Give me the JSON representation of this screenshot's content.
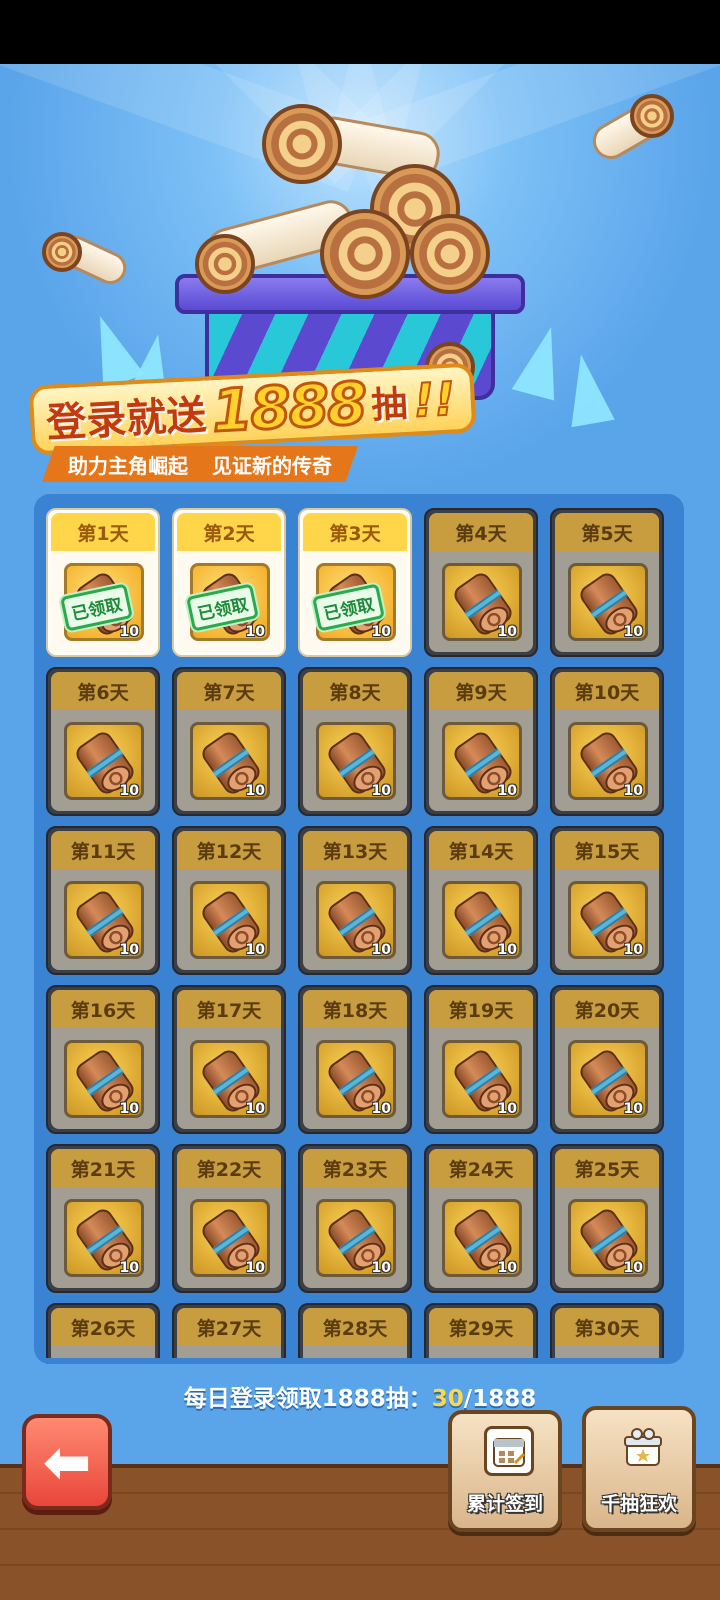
{
  "banner": {
    "title_prefix": "登录就送",
    "title_number": "1888",
    "title_suffix": "抽",
    "title_bang": "!!",
    "subtitle_left": "助力主角崛起",
    "subtitle_right": "见证新的传奇"
  },
  "days": [
    {
      "label": "第1天",
      "qty": "10",
      "claimed": true,
      "stamp": "已领取"
    },
    {
      "label": "第2天",
      "qty": "10",
      "claimed": true,
      "stamp": "已领取"
    },
    {
      "label": "第3天",
      "qty": "10",
      "claimed": true,
      "stamp": "已领取"
    },
    {
      "label": "第4天",
      "qty": "10",
      "claimed": false
    },
    {
      "label": "第5天",
      "qty": "10",
      "claimed": false
    },
    {
      "label": "第6天",
      "qty": "10",
      "claimed": false
    },
    {
      "label": "第7天",
      "qty": "10",
      "claimed": false
    },
    {
      "label": "第8天",
      "qty": "10",
      "claimed": false
    },
    {
      "label": "第9天",
      "qty": "10",
      "claimed": false
    },
    {
      "label": "第10天",
      "qty": "10",
      "claimed": false
    },
    {
      "label": "第11天",
      "qty": "10",
      "claimed": false
    },
    {
      "label": "第12天",
      "qty": "10",
      "claimed": false
    },
    {
      "label": "第13天",
      "qty": "10",
      "claimed": false
    },
    {
      "label": "第14天",
      "qty": "10",
      "claimed": false
    },
    {
      "label": "第15天",
      "qty": "10",
      "claimed": false
    },
    {
      "label": "第16天",
      "qty": "10",
      "claimed": false
    },
    {
      "label": "第17天",
      "qty": "10",
      "claimed": false
    },
    {
      "label": "第18天",
      "qty": "10",
      "claimed": false
    },
    {
      "label": "第19天",
      "qty": "10",
      "claimed": false
    },
    {
      "label": "第20天",
      "qty": "10",
      "claimed": false
    },
    {
      "label": "第21天",
      "qty": "10",
      "claimed": false
    },
    {
      "label": "第22天",
      "qty": "10",
      "claimed": false
    },
    {
      "label": "第23天",
      "qty": "10",
      "claimed": false
    },
    {
      "label": "第24天",
      "qty": "10",
      "claimed": false
    },
    {
      "label": "第25天",
      "qty": "10",
      "claimed": false
    },
    {
      "label": "第26天",
      "claimed": false
    },
    {
      "label": "第27天",
      "claimed": false
    },
    {
      "label": "第28天",
      "claimed": false
    },
    {
      "label": "第29天",
      "claimed": false
    },
    {
      "label": "第30天",
      "claimed": false
    }
  ],
  "progress": {
    "label": "每日登录领取1888抽：",
    "current": "30",
    "total": "/1888"
  },
  "buttons": {
    "back_icon": "arrow-left-icon",
    "cumulative_label": "累计签到",
    "cumulative_icon": "calendar-icon",
    "draw_label": "千抽狂欢",
    "draw_icon": "gift-box-icon"
  },
  "colors": {
    "background": "#5aa4ea",
    "panel": "#3a82d2",
    "claimed_header": "#ffd64a",
    "locked_header": "#c79d3f",
    "stamp_green": "#2da84a",
    "progress_current": "#ffd84a",
    "back_button": "#e9463a"
  }
}
